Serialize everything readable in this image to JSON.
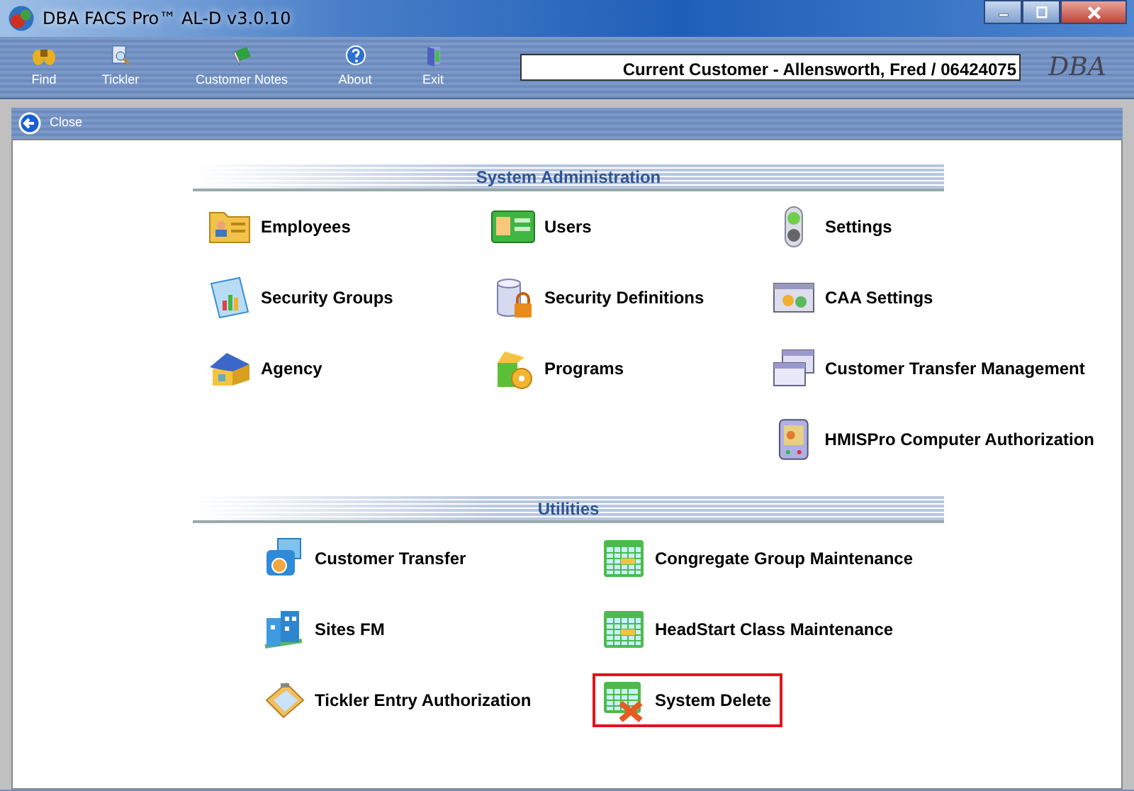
{
  "window": {
    "title": "DBA FACS Pro™ AL-D v3.0.10"
  },
  "toolbar": [
    {
      "label": "Find"
    },
    {
      "label": "Tickler"
    },
    {
      "label": "Customer Notes"
    },
    {
      "label": "About"
    },
    {
      "label": "Exit"
    }
  ],
  "current_customer": "Current Customer - Allensworth, Fred / 06424075",
  "logo": "DBA",
  "close_button": "Close",
  "sections": [
    {
      "title": "System Administration",
      "kind": "admin",
      "columns": [
        [
          {
            "label": "Employees",
            "selected": false
          },
          {
            "label": "Security Groups",
            "selected": false
          },
          {
            "label": "Agency",
            "selected": false
          }
        ],
        [
          {
            "label": "Users",
            "selected": false
          },
          {
            "label": "Security Definitions",
            "selected": false
          },
          {
            "label": "Programs",
            "selected": false
          }
        ],
        [
          {
            "label": "Settings",
            "selected": false
          },
          {
            "label": "CAA Settings",
            "selected": false
          },
          {
            "label": "Customer Transfer Management",
            "selected": false
          },
          {
            "label": "HMISPro Computer Authorization",
            "selected": false
          }
        ]
      ]
    },
    {
      "title": "Utilities",
      "kind": "utilities",
      "columns": [
        [
          {
            "label": "Customer Transfer",
            "selected": false
          },
          {
            "label": "Sites FM",
            "selected": false
          },
          {
            "label": "Tickler Entry Authorization",
            "selected": false
          }
        ],
        [
          {
            "label": "Congregate Group Maintenance",
            "selected": false
          },
          {
            "label": "HeadStart Class Maintenance",
            "selected": false
          },
          {
            "label": "System Delete",
            "selected": true
          }
        ]
      ]
    }
  ]
}
